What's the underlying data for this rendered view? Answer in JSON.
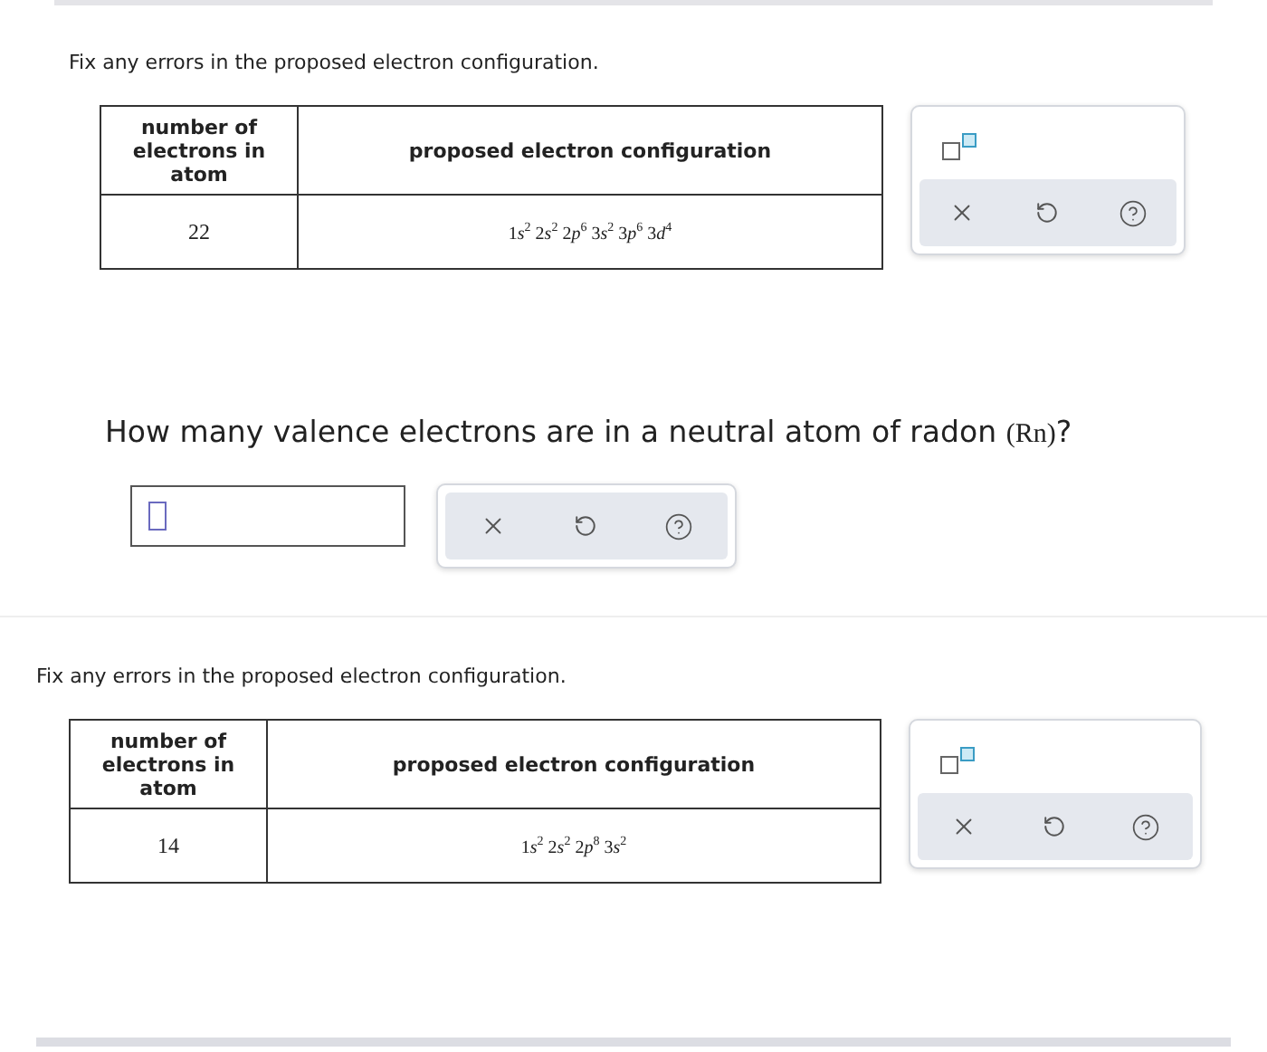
{
  "sections": [
    {
      "kind": "table",
      "prompt": "Fix any errors in the proposed electron configuration.",
      "columns": [
        "number of electrons in atom",
        "proposed electron configuration"
      ],
      "electrons": "22",
      "terms": [
        {
          "shell": "1",
          "orbital": "s",
          "count": "2"
        },
        {
          "shell": "2",
          "orbital": "s",
          "count": "2"
        },
        {
          "shell": "2",
          "orbital": "p",
          "count": "6"
        },
        {
          "shell": "3",
          "orbital": "s",
          "count": "2"
        },
        {
          "shell": "3",
          "orbital": "p",
          "count": "6"
        },
        {
          "shell": "3",
          "orbital": "d",
          "count": "4"
        }
      ]
    },
    {
      "kind": "question",
      "prompt": "How many valence electrons are in a neutral atom of radon",
      "symbol": "(Rn)",
      "end": "?"
    },
    {
      "kind": "table",
      "prompt": "Fix any errors in the proposed electron configuration.",
      "columns": [
        "number of electrons in atom",
        "proposed electron configuration"
      ],
      "electrons": "14",
      "terms": [
        {
          "shell": "1",
          "orbital": "s",
          "count": "2"
        },
        {
          "shell": "2",
          "orbital": "s",
          "count": "2"
        },
        {
          "shell": "2",
          "orbital": "p",
          "count": "8"
        },
        {
          "shell": "3",
          "orbital": "s",
          "count": "2"
        }
      ]
    }
  ]
}
